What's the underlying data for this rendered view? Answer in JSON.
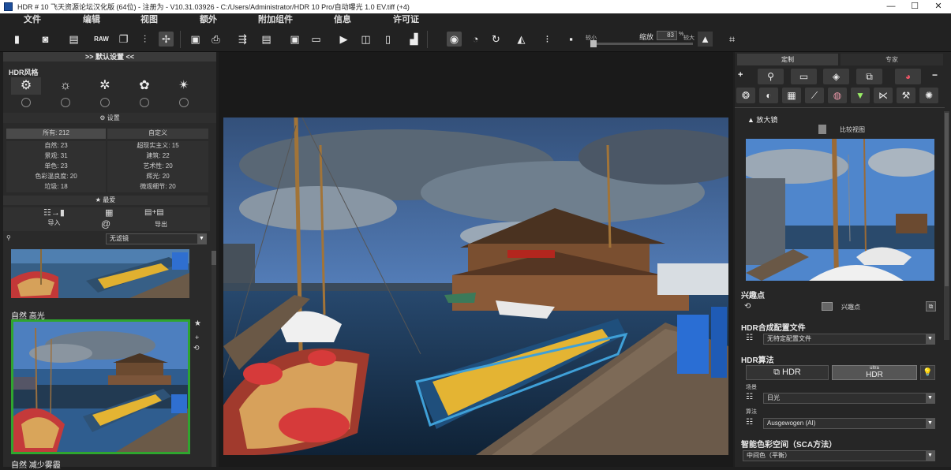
{
  "window": {
    "title": "HDR # 10 飞天资源论坛汉化版 (64位) - 注册为 - V10.31.03926 - C:/Users/Administrator/HDR 10 Pro/自动曝光 1.0 EV.tiff (+4)",
    "minimize": "—",
    "maximize": "☐",
    "close": "✕"
  },
  "menu": [
    "文件",
    "编辑",
    "视图",
    "额外",
    "附加组件",
    "信息",
    "许可证"
  ],
  "toolbar": {
    "zoom_label": "缩放",
    "zoom_value": "83",
    "zoom_unit": "%",
    "min_label": "较小",
    "max_label": "较大"
  },
  "left": {
    "header": ">> 默认设置 <<",
    "style_title": "HDR风格",
    "settings_label": "设置",
    "categories": [
      {
        "name": "所有",
        "count": "212"
      },
      {
        "name": "自定义",
        "count": ""
      },
      {
        "name": "自然",
        "count": "23"
      },
      {
        "name": "超现实主义",
        "count": "15"
      },
      {
        "name": "景观",
        "count": "31"
      },
      {
        "name": "建筑",
        "count": "22"
      },
      {
        "name": "单色",
        "count": "23"
      },
      {
        "name": "艺术性",
        "count": "20"
      },
      {
        "name": "色彩温良度",
        "count": "20"
      },
      {
        "name": "辉光",
        "count": "20"
      },
      {
        "name": "垃圾",
        "count": "18"
      },
      {
        "name": "微观细节",
        "count": "20"
      }
    ],
    "favorites": "最爱",
    "import": "导入",
    "export": "导出",
    "filter_value": "无滤镜",
    "preset1": "自然 高光",
    "preset2": "自然 减少雾霾"
  },
  "right": {
    "tabs": [
      "定制",
      "专家"
    ],
    "magnifier_title": "放大镜",
    "compare_label": "比较视图",
    "poi_title": "兴趣点",
    "poi_label": "兴趣点",
    "profile_title": "HDR合成配置文件",
    "profile_value": "无特定配置文件",
    "algo_title": "HDR算法",
    "hdr_button": "HDR",
    "ultra_small": "ultra",
    "ultra_big": "HDR",
    "scene_label": "场景",
    "scene_value": "日光",
    "algo_label": "算法",
    "algo_value": "Ausgewogen (AI)",
    "sca_title": "智能色彩空间（SCA方法）",
    "sca_value": "中间色（平衡）"
  }
}
